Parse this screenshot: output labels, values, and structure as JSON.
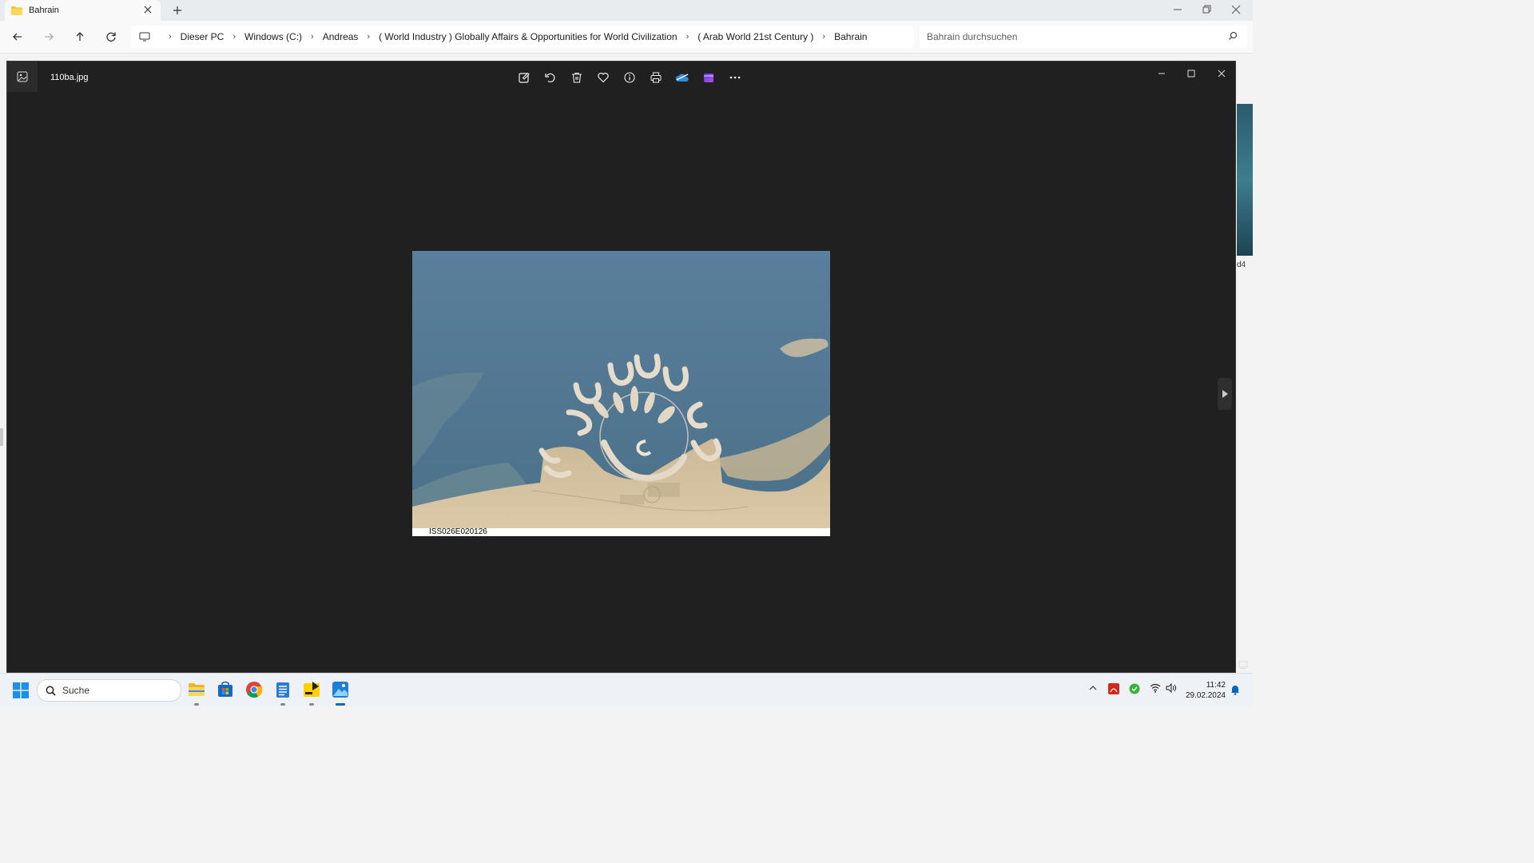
{
  "explorer": {
    "tab_title": "Bahrain",
    "breadcrumbs": [
      "Dieser PC",
      "Windows (C:)",
      "Andreas",
      "( World Industry ) Globally Affairs & Opportunities for World Civilization",
      "( Arab World 21st Century )",
      "Bahrain"
    ],
    "search_placeholder": "Bahrain durchsuchen",
    "side_label": "d4"
  },
  "viewer": {
    "file_name": "110ba.jpg",
    "toolbar_icons": [
      "edit-image-icon",
      "rotate-icon",
      "delete-icon",
      "favorite-icon",
      "info-icon",
      "print-icon",
      "onedrive-icon",
      "clipchamp-icon",
      "more-icon"
    ],
    "photo_caption": "ISS026E020126"
  },
  "taskbar": {
    "search_placeholder": "Suche",
    "time": "11:42",
    "date": "29.02.2024",
    "apps": [
      "file-explorer-icon",
      "store-icon",
      "chrome-icon",
      "notepad-icon",
      "player-icon",
      "photos-icon"
    ]
  },
  "colors": {
    "accent": "#0067c0",
    "viewer_bg": "#202020",
    "sea": "#4d7391",
    "land": "#d8c6a4"
  }
}
